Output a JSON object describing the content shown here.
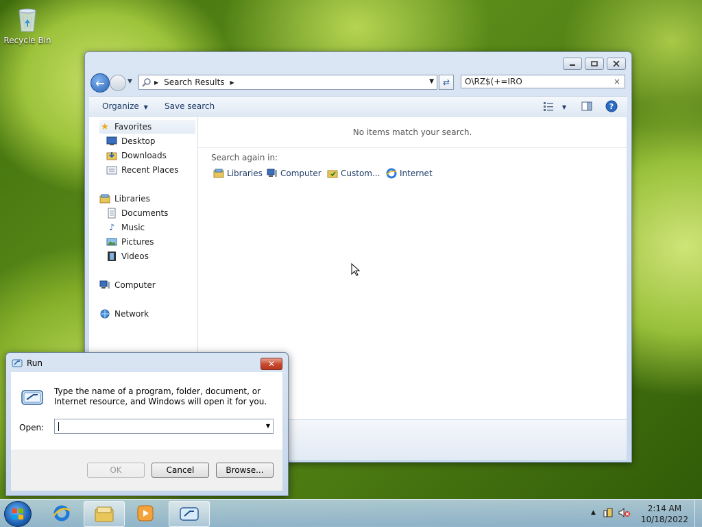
{
  "desktop": {
    "recycle_bin_label": "Recycle Bin"
  },
  "explorer": {
    "address": {
      "crumbs": [
        "Search Results"
      ]
    },
    "search": {
      "value": "O\\RZ$(+=IRO"
    },
    "toolbar": {
      "organize_label": "Organize",
      "save_search_label": "Save search"
    },
    "nav_pane": {
      "favorites": {
        "label": "Favorites",
        "items": [
          "Desktop",
          "Downloads",
          "Recent Places"
        ]
      },
      "libraries": {
        "label": "Libraries",
        "items": [
          "Documents",
          "Music",
          "Pictures",
          "Videos"
        ]
      },
      "computer_label": "Computer",
      "network_label": "Network"
    },
    "content": {
      "no_items_text": "No items match your search.",
      "search_again_label": "Search again in:",
      "search_again_items": [
        "Libraries",
        "Computer",
        "Custom...",
        "Internet"
      ]
    }
  },
  "run_dialog": {
    "title": "Run",
    "description": "Type the name of a program, folder, document, or Internet resource, and Windows will open it for you.",
    "open_label": "Open:",
    "open_value": "",
    "buttons": {
      "ok": "OK",
      "cancel": "Cancel",
      "browse": "Browse..."
    }
  },
  "taskbar": {
    "clock_time": "2:14 AM",
    "clock_date": "10/18/2022",
    "pinned": [
      "internet-explorer-icon",
      "windows-explorer-icon",
      "media-player-icon",
      "run-icon"
    ]
  },
  "colors": {
    "accent": "#2a65b8",
    "close_red": "#c8472c"
  }
}
